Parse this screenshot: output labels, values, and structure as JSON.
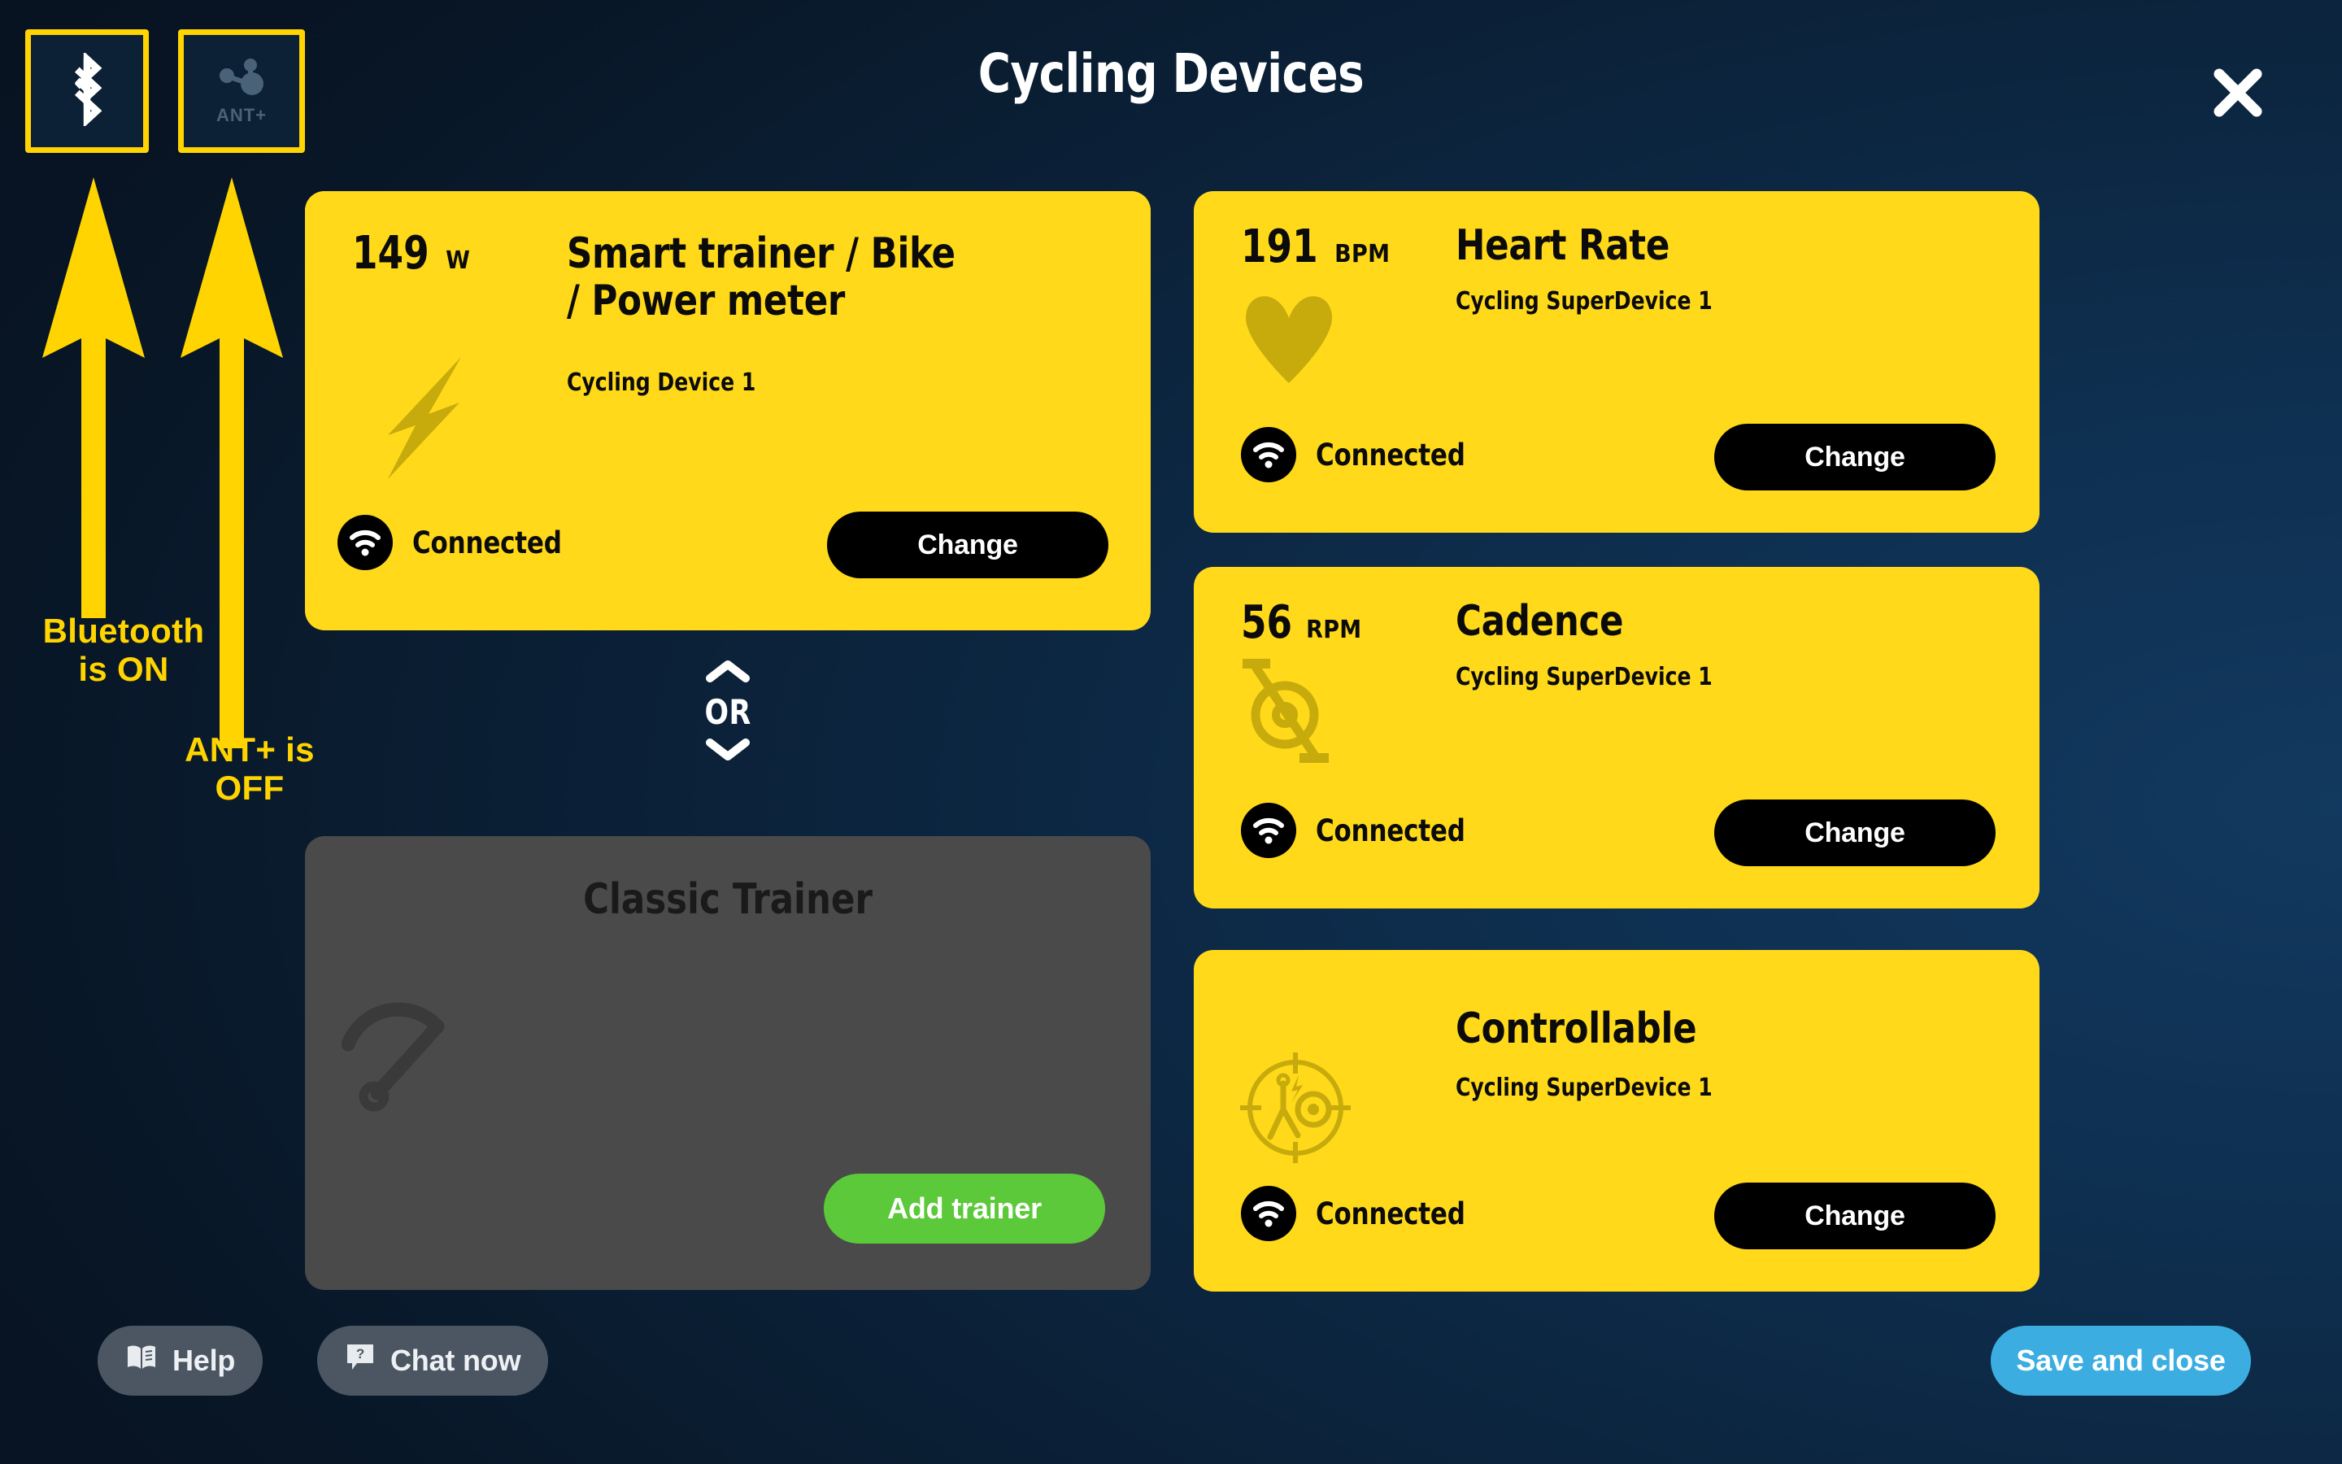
{
  "header": {
    "title": "Cycling Devices",
    "close_icon": "close-icon"
  },
  "protocol_toggles": [
    {
      "id": "bluetooth",
      "icon": "bluetooth-icon",
      "label": "",
      "state": "ON",
      "highlighted": true
    },
    {
      "id": "ant_plus",
      "icon": "ant-plus-icon",
      "label": "ANT+",
      "state": "OFF",
      "highlighted": true
    }
  ],
  "annotations": [
    {
      "id": "bluetooth_note",
      "text": "Bluetooth\nis ON",
      "line1": "Bluetooth",
      "line2": "is ON",
      "color": "#ffd400",
      "arrow": "arrow-up-bluetooth"
    },
    {
      "id": "ant_note",
      "text": "ANT+ is\nOFF",
      "line1": "ANT+ is",
      "line2": "OFF",
      "color": "#ffd400",
      "arrow": "arrow-up-ant"
    }
  ],
  "divider": {
    "label": "OR",
    "chevron_up": "chevron-up-icon",
    "chevron_down": "chevron-down-icon"
  },
  "power_card": {
    "metric_value": "149",
    "metric_unit": "W",
    "title_line1": "Smart trainer / Bike",
    "title_line2": "/ Power meter",
    "device_name": "Cycling Device 1",
    "status": "Connected",
    "status_icon": "wifi-icon",
    "deco_icon": "lightning-bolt-icon",
    "change_label": "Change"
  },
  "classic_trainer": {
    "title": "Classic Trainer",
    "deco_icon": "speedometer-icon",
    "add_label": "Add trainer",
    "add_color": "#5bc939"
  },
  "right_cards": [
    {
      "id": "heart_rate",
      "metric_value": "191",
      "metric_unit": "BPM",
      "title": "Heart Rate",
      "device_name": "Cycling SuperDevice 1",
      "status": "Connected",
      "status_icon": "wifi-icon",
      "deco_icon": "heart-icon",
      "change_label": "Change"
    },
    {
      "id": "cadence",
      "metric_value": "56",
      "metric_unit": "RPM",
      "title": "Cadence",
      "device_name": "Cycling SuperDevice 1",
      "status": "Connected",
      "status_icon": "wifi-icon",
      "deco_icon": "crank-pedal-icon",
      "change_label": "Change"
    },
    {
      "id": "controllable",
      "metric_value": "",
      "metric_unit": "",
      "title": "Controllable",
      "device_name": "Cycling SuperDevice 1",
      "status": "Connected",
      "status_icon": "wifi-icon",
      "deco_icon": "trainer-control-icon",
      "change_label": "Change"
    }
  ],
  "footer": {
    "help_label": "Help",
    "help_icon": "book-icon",
    "chat_label": "Chat now",
    "chat_icon": "chat-question-icon",
    "save_label": "Save and close",
    "save_color": "#3cade0"
  },
  "colors": {
    "accent_yellow": "#ffd91a",
    "annotation_yellow": "#ffd400",
    "card_dark": "#4a4a4a",
    "background_navy": "#0b2338",
    "green": "#5bc939",
    "blue": "#3cade0"
  }
}
